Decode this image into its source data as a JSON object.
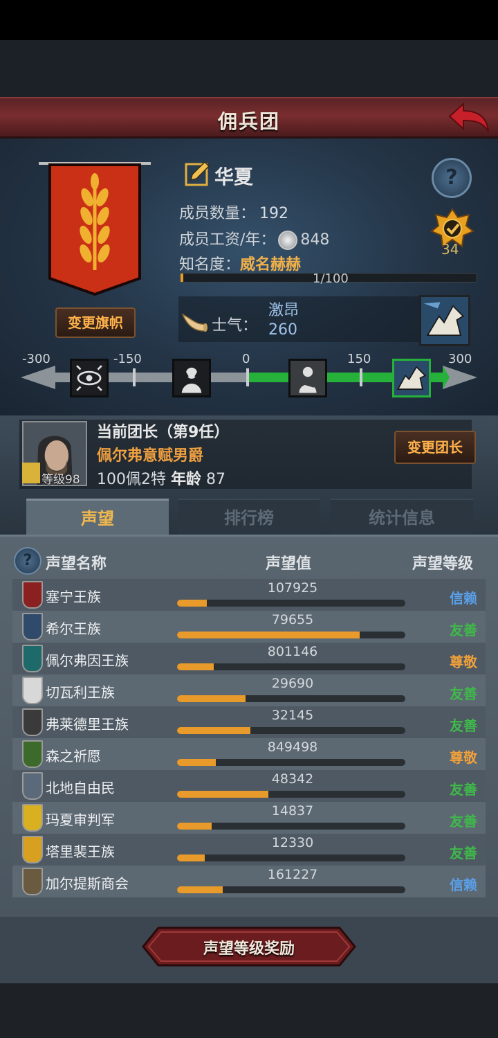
{
  "header": {
    "title": "佣兵团",
    "back_icon": "back-arrow-icon"
  },
  "mercenary": {
    "name": "华夏",
    "change_flag_label": "变更旗帜",
    "members_label": "成员数量：",
    "members_value": "192",
    "salary_label": "成员工资/年：",
    "salary_value": "848",
    "fame_label": "知名度：",
    "fame_value": "威名赫赫",
    "fame_progress_text": "1/100",
    "fame_progress": 0.01,
    "rank_badge_value": "34",
    "help_icon": "?"
  },
  "morale": {
    "label": "士气：",
    "state": "激昂",
    "value": "260",
    "scale_min": -300,
    "scale_max": 300,
    "current": 260,
    "ticks": [
      "-300",
      "-150",
      "0",
      "150",
      "300"
    ]
  },
  "leader": {
    "title": "当前团长（第9任）",
    "name": "佩尔弗意赋男爵",
    "level_text": "等级98",
    "stats_prefix": "100佩2特",
    "age_label": "年龄",
    "age_value": "87",
    "change_leader_label": "变更团长"
  },
  "tabs": [
    {
      "label": "声望",
      "active": true
    },
    {
      "label": "排行榜",
      "active": false
    },
    {
      "label": "统计信息",
      "active": false
    }
  ],
  "reputation": {
    "col_name": "声望名称",
    "col_value": "声望值",
    "col_level": "声望等级",
    "rows": [
      {
        "name": "塞宁王族",
        "value": "107925",
        "fill": 0.13,
        "level": "信赖",
        "level_color": "#5aa0ea",
        "crest": "#8b2020"
      },
      {
        "name": "希尔王族",
        "value": "79655",
        "fill": 0.8,
        "level": "友善",
        "level_color": "#3fb94a",
        "crest": "#2f4a6a"
      },
      {
        "name": "佩尔弗因王族",
        "value": "801146",
        "fill": 0.16,
        "level": "尊敬",
        "level_color": "#f0a03a",
        "crest": "#1e6a6a"
      },
      {
        "name": "切瓦利王族",
        "value": "29690",
        "fill": 0.3,
        "level": "友善",
        "level_color": "#3fb94a",
        "crest": "#d8d8d8"
      },
      {
        "name": "弗莱德里王族",
        "value": "32145",
        "fill": 0.32,
        "level": "友善",
        "level_color": "#3fb94a",
        "crest": "#3a3a3a"
      },
      {
        "name": "森之祈愿",
        "value": "849498",
        "fill": 0.17,
        "level": "尊敬",
        "level_color": "#f0a03a",
        "crest": "#3c6a2a"
      },
      {
        "name": "北地自由民",
        "value": "48342",
        "fill": 0.4,
        "level": "友善",
        "level_color": "#3fb94a",
        "crest": "#5a6a7a"
      },
      {
        "name": "玛夏审判军",
        "value": "14837",
        "fill": 0.15,
        "level": "友善",
        "level_color": "#3fb94a",
        "crest": "#d8b020"
      },
      {
        "name": "塔里裴王族",
        "value": "12330",
        "fill": 0.12,
        "level": "友善",
        "level_color": "#3fb94a",
        "crest": "#d8a020"
      },
      {
        "name": "加尔提斯商会",
        "value": "161227",
        "fill": 0.2,
        "level": "信赖",
        "level_color": "#5aa0ea",
        "crest": "#6a5a40"
      }
    ]
  },
  "footer": {
    "reward_label": "声望等级奖励"
  }
}
